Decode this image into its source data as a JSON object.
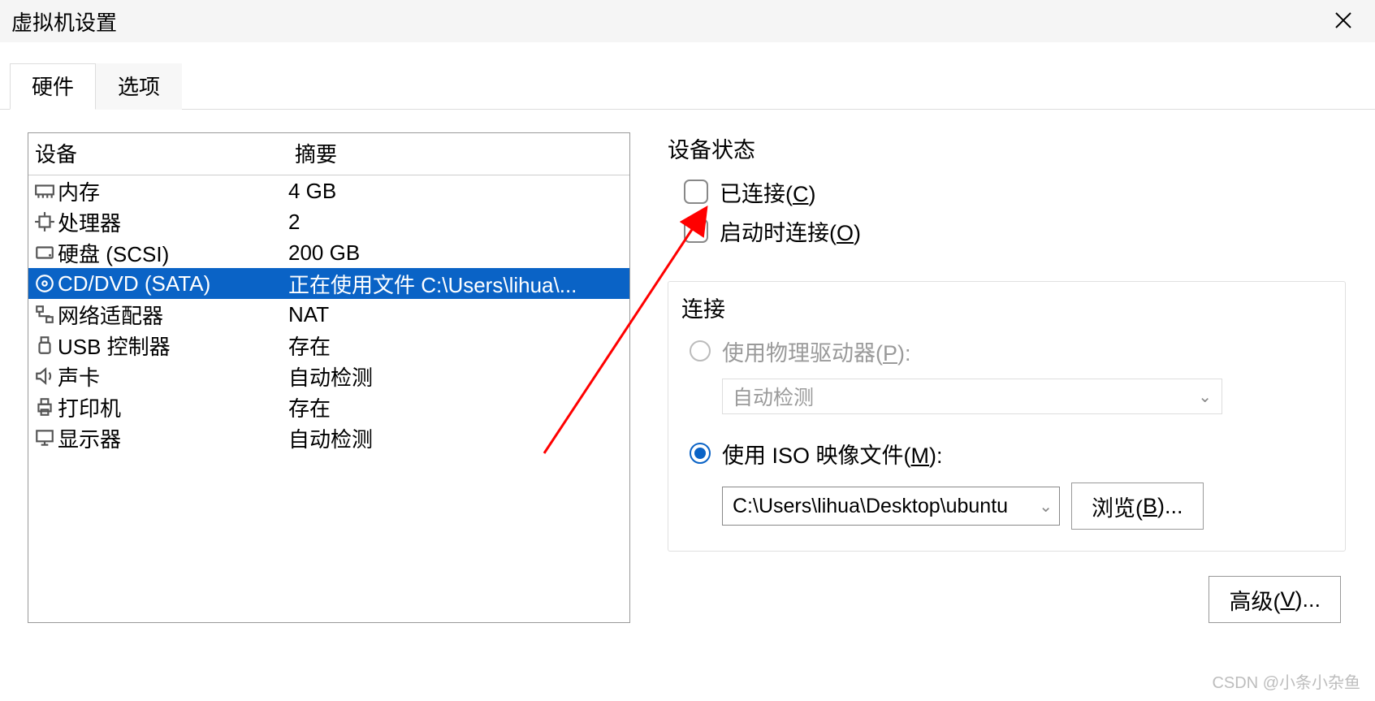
{
  "window": {
    "title": "虚拟机设置"
  },
  "tabs": {
    "hardware": "硬件",
    "options": "选项"
  },
  "device_list": {
    "header_device": "设备",
    "header_summary": "摘要",
    "rows": [
      {
        "icon": "memory",
        "name": "内存",
        "summary": "4 GB"
      },
      {
        "icon": "cpu",
        "name": "处理器",
        "summary": "2"
      },
      {
        "icon": "disk",
        "name": "硬盘 (SCSI)",
        "summary": "200 GB"
      },
      {
        "icon": "cd",
        "name": "CD/DVD (SATA)",
        "summary": "正在使用文件 C:\\Users\\lihua\\..."
      },
      {
        "icon": "net",
        "name": "网络适配器",
        "summary": "NAT"
      },
      {
        "icon": "usb",
        "name": "USB 控制器",
        "summary": "存在"
      },
      {
        "icon": "sound",
        "name": "声卡",
        "summary": "自动检测"
      },
      {
        "icon": "printer",
        "name": "打印机",
        "summary": "存在"
      },
      {
        "icon": "display",
        "name": "显示器",
        "summary": "自动检测"
      }
    ],
    "selected_index": 3
  },
  "right": {
    "device_status_title": "设备状态",
    "connected_pre": "已连接(",
    "connected_key": "C",
    "connected_post": ")",
    "connect_at_power_pre": "启动时连接(",
    "connect_at_power_key": "O",
    "connect_at_power_post": ")",
    "connection_title": "连接",
    "physical_pre": "使用物理驱动器(",
    "physical_key": "P",
    "physical_post": "):",
    "physical_combo": "自动检测",
    "iso_pre": "使用 ISO 映像文件(",
    "iso_key": "M",
    "iso_post": "):",
    "iso_path": "C:\\Users\\lihua\\Desktop\\ubuntu",
    "browse_pre": "浏览(",
    "browse_key": "B",
    "browse_post": ")...",
    "advanced_pre": "高级(",
    "advanced_key": "V",
    "advanced_post": ")..."
  },
  "watermark": "CSDN @小条小杂鱼"
}
